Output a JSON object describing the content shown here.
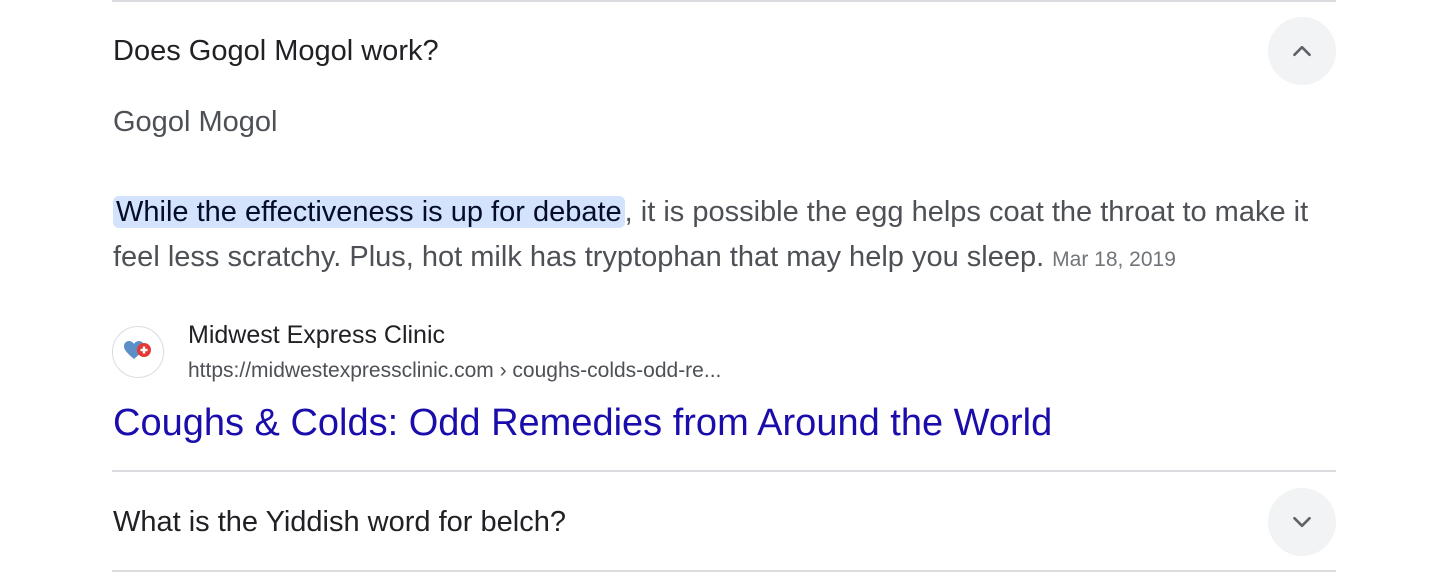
{
  "faq": [
    {
      "question": "Does Gogol Mogol work?",
      "expanded": true,
      "toggle_icon": "chevron-up-icon",
      "answer": {
        "heading": "Gogol Mogol",
        "highlighted_text": "While the effectiveness is up for debate",
        "rest_text": ", it is possible the egg helps coat the throat to make it feel less scratchy. Plus, hot milk has tryptophan that may help you sleep.",
        "date": "Mar 18, 2019"
      },
      "source": {
        "name": "Midwest Express Clinic",
        "url": "https://midwestexpressclinic.com › coughs-colds-odd-re...",
        "favicon_icon": "heart-plus-icon",
        "title": "Coughs & Colds: Odd Remedies from Around the World"
      }
    },
    {
      "question": "What is the Yiddish word for belch?",
      "expanded": false,
      "toggle_icon": "chevron-down-icon"
    }
  ],
  "colors": {
    "link": "#1a0dab",
    "highlight": "#d3e3fd",
    "divider": "#dadce0",
    "toggle_bg": "#f1f3f4"
  }
}
